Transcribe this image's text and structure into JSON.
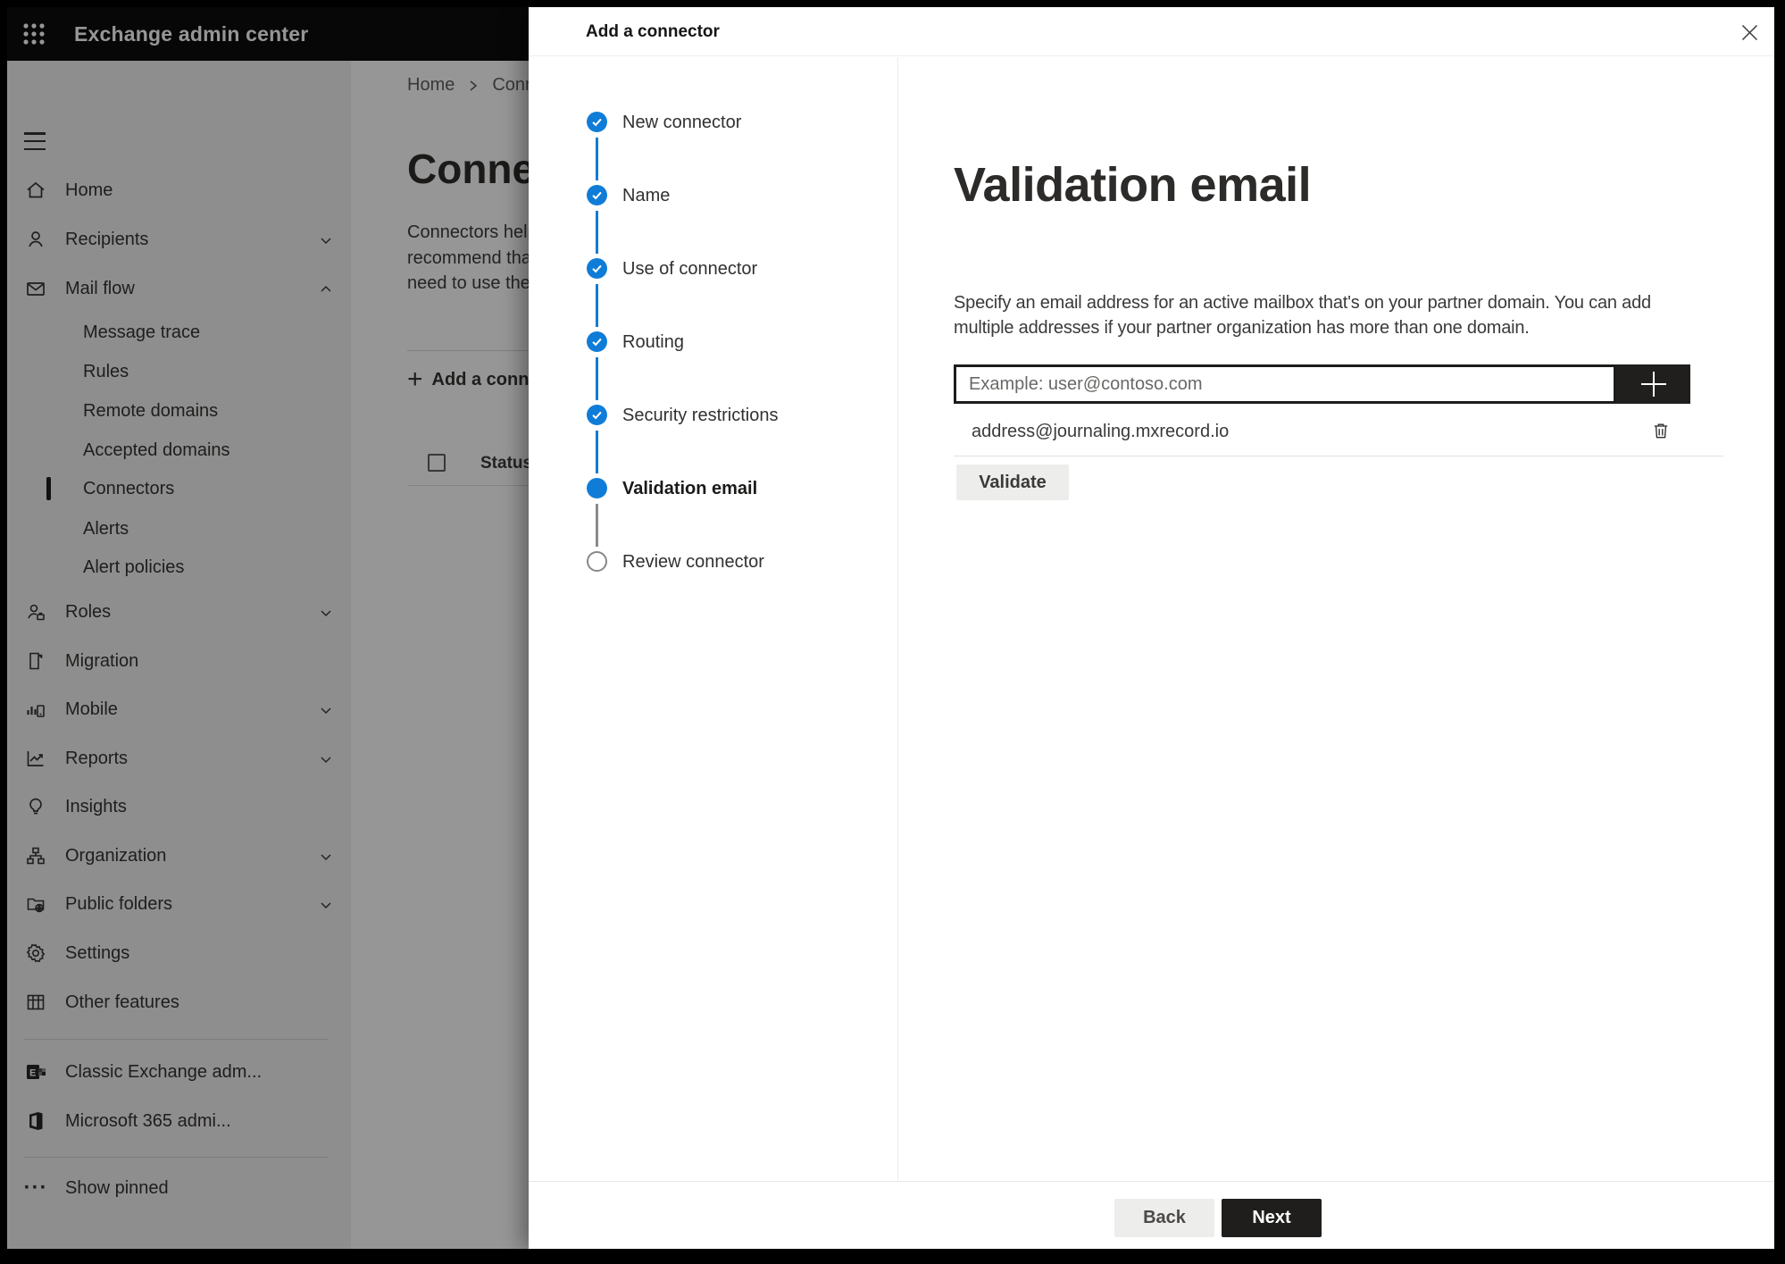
{
  "colors": {
    "accent_blue": "#0f7dd7",
    "topbar_bg": "#0a0a0a",
    "dark_button": "#1f1e1d",
    "sidebar_bg": "#f3f2f1",
    "selected_indicator": "#1b1a19"
  },
  "topbar": {
    "title": "Exchange admin center"
  },
  "sidebar": {
    "items": [
      {
        "label": "Home"
      },
      {
        "label": "Recipients"
      },
      {
        "label": "Mail flow"
      },
      {
        "label": "Message trace"
      },
      {
        "label": "Rules"
      },
      {
        "label": "Remote domains"
      },
      {
        "label": "Accepted domains"
      },
      {
        "label": "Connectors"
      },
      {
        "label": "Alerts"
      },
      {
        "label": "Alert policies"
      },
      {
        "label": "Roles"
      },
      {
        "label": "Migration"
      },
      {
        "label": "Mobile"
      },
      {
        "label": "Reports"
      },
      {
        "label": "Insights"
      },
      {
        "label": "Organization"
      },
      {
        "label": "Public folders"
      },
      {
        "label": "Settings"
      },
      {
        "label": "Other features"
      },
      {
        "label": "Classic Exchange adm..."
      },
      {
        "label": "Microsoft 365 admi..."
      },
      {
        "label": "Show pinned"
      }
    ]
  },
  "main": {
    "breadcrumb": {
      "home": "Home",
      "current": "Connectors"
    },
    "title": "Connectors",
    "description_lines": [
      "Connectors help",
      "recommend that",
      "need to use ther"
    ],
    "add_button_label": "Add a connector",
    "table": {
      "columns": [
        "Status"
      ]
    }
  },
  "panel": {
    "title": "Add a connector",
    "steps": [
      {
        "label": "New connector",
        "state": "complete"
      },
      {
        "label": "Name",
        "state": "complete"
      },
      {
        "label": "Use of connector",
        "state": "complete"
      },
      {
        "label": "Routing",
        "state": "complete"
      },
      {
        "label": "Security restrictions",
        "state": "complete"
      },
      {
        "label": "Validation email",
        "state": "current"
      },
      {
        "label": "Review connector",
        "state": "upcoming"
      }
    ],
    "content": {
      "heading": "Validation email",
      "instructions_lines": [
        "Specify an email address for an active mailbox that's on your partner domain. You can add",
        "multiple addresses if your partner organization has more than one domain."
      ],
      "email_input": {
        "value": "",
        "placeholder": "Example: user@contoso.com"
      },
      "addresses": [
        "address@journaling.mxrecord.io"
      ],
      "validate_button": "Validate"
    },
    "footer": {
      "back": "Back",
      "next": "Next"
    }
  }
}
